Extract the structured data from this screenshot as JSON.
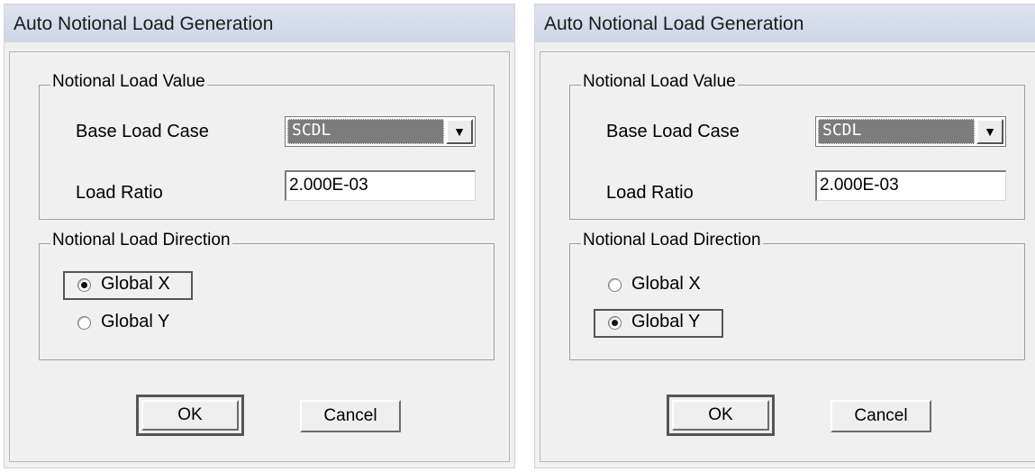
{
  "dialogs": [
    {
      "title": "Auto Notional Load Generation",
      "value_group": {
        "legend": "Notional Load Value",
        "base_load_case_label": "Base Load Case",
        "base_load_case_value": "SCDL",
        "load_ratio_label": "Load Ratio",
        "load_ratio_value": "2.000E-03"
      },
      "direction_group": {
        "legend": "Notional Load Direction",
        "option_x": "Global X",
        "option_y": "Global Y",
        "selected": "Global X"
      },
      "ok_label": "OK",
      "cancel_label": "Cancel"
    },
    {
      "title": "Auto Notional Load Generation",
      "value_group": {
        "legend": "Notional Load Value",
        "base_load_case_label": "Base Load Case",
        "base_load_case_value": "SCDL",
        "load_ratio_label": "Load Ratio",
        "load_ratio_value": "2.000E-03"
      },
      "direction_group": {
        "legend": "Notional Load Direction",
        "option_x": "Global X",
        "option_y": "Global Y",
        "selected": "Global Y"
      },
      "ok_label": "OK",
      "cancel_label": "Cancel"
    }
  ],
  "icons": {
    "dropdown": "chevron-down-icon",
    "radio": "radio-icon"
  },
  "colors": {
    "dialog_bg": "#f0f0f0",
    "titlebar": "#d6dbe9",
    "selected_combo_bg": "#7c7c7c",
    "highlight_border": "#555555"
  }
}
